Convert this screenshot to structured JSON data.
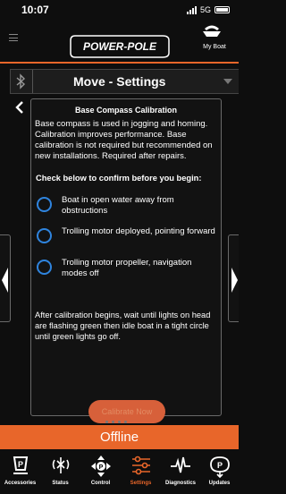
{
  "status_bar": {
    "time": "10:07",
    "network": "5G"
  },
  "header": {
    "logo_text": "POWER-POLE",
    "boat_label": "My Boat"
  },
  "selector": {
    "title": "Move - Settings"
  },
  "dialog": {
    "title": "Base Compass Calibration",
    "intro": "Base compass is used in jogging and homing. Calibration improves performance. Base calibration is not required but recommended on new installations. Required after repairs.",
    "check_heading": "Check below to confirm before you begin:",
    "options": [
      {
        "label": "Boat in open water away from obstructions",
        "checked": false
      },
      {
        "label": "Trolling motor deployed, pointing forward",
        "checked": false
      },
      {
        "label": "Trolling motor propeller, navigation modes off",
        "checked": false
      }
    ],
    "note": "After calibration begins, wait until lights on head are flashing green then idle boat in a tight circle until green lights go off.",
    "begin_button": "Calibrate Now"
  },
  "connection_status": "Offline",
  "tabs": [
    {
      "label": "Accessories",
      "icon": "accessories-icon",
      "active": false
    },
    {
      "label": "Status",
      "icon": "status-icon",
      "active": false
    },
    {
      "label": "Control",
      "icon": "control-icon",
      "active": false
    },
    {
      "label": "Settings",
      "icon": "settings-icon",
      "active": true
    },
    {
      "label": "Diagnostics",
      "icon": "diagnostics-icon",
      "active": false
    },
    {
      "label": "Updates",
      "icon": "updates-icon",
      "active": false
    }
  ],
  "colors": {
    "accent": "#e8662a",
    "radio": "#2f84de",
    "background": "#0e0e0e"
  }
}
